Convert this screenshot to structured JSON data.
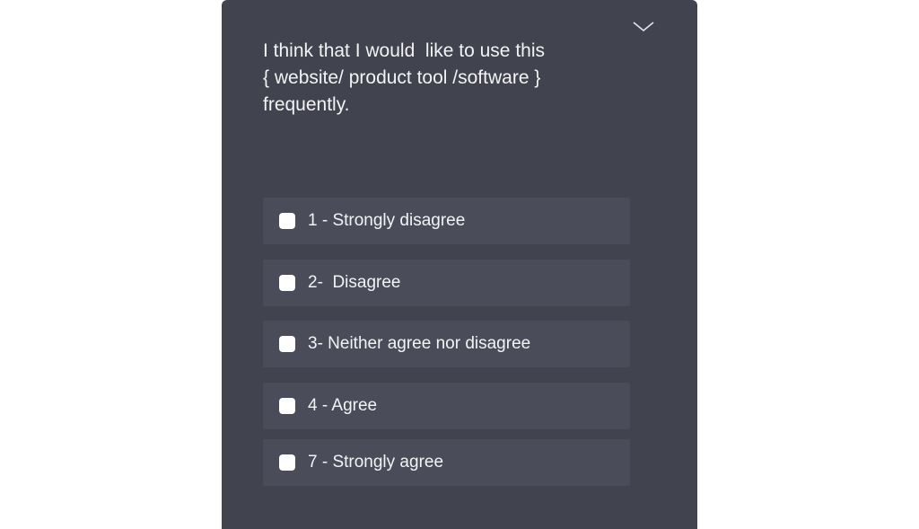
{
  "question": {
    "text": "I think that I would  like to use this\n{ website/ product tool /software }\nfrequently."
  },
  "toggle": {
    "icon": "chevron-down-icon"
  },
  "options": [
    {
      "label": "1 - Strongly disagree",
      "checked": false
    },
    {
      "label": "2-  Disagree",
      "checked": false
    },
    {
      "label": "3- Neither agree nor disagree",
      "checked": false
    },
    {
      "label": "4 - Agree",
      "checked": false
    },
    {
      "label": "7 - Strongly agree",
      "checked": false
    }
  ],
  "colors": {
    "card_background": "#41434f",
    "option_background": "#4a4d59",
    "text": "#f3f3f5",
    "checkbox": "#ffffff"
  }
}
